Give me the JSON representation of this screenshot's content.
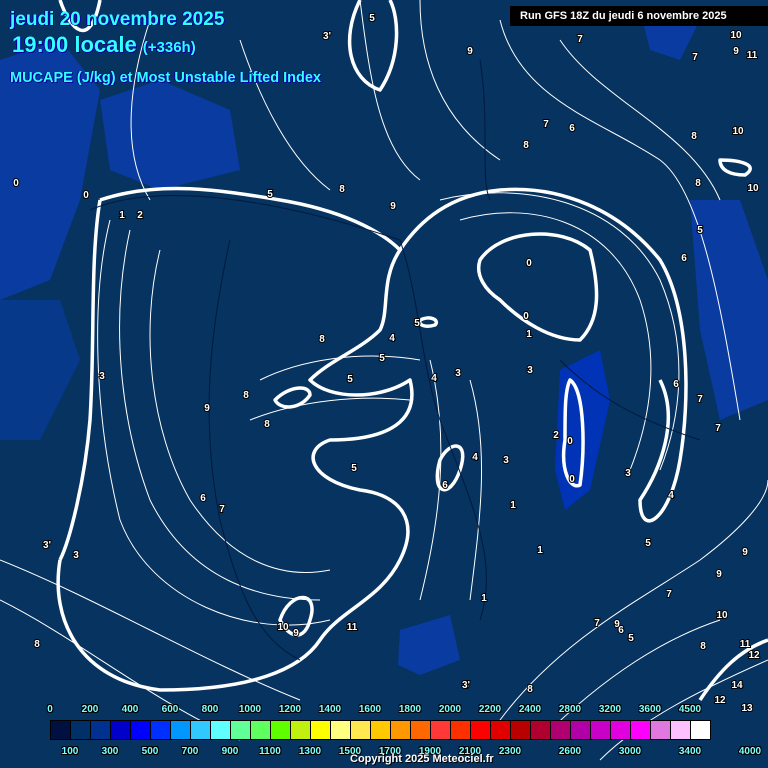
{
  "header": {
    "date": "jeudi 20 novembre 2025",
    "time": "19:00 locale",
    "lead": "(+336h)",
    "parameter": "MUCAPE (J/kg) et Most Unstable Lifted Index",
    "run": "Run GFS 18Z du jeudi 6 novembre 2025"
  },
  "legend": {
    "colors": [
      "#001040",
      "#003068",
      "#003090",
      "#0000c8",
      "#0000ff",
      "#0030ff",
      "#0098ff",
      "#30c8ff",
      "#60ffff",
      "#60ff98",
      "#60ff60",
      "#60ff00",
      "#c0f010",
      "#ffff00",
      "#ffff80",
      "#ffe850",
      "#ffc800",
      "#ff9800",
      "#ff6800",
      "#ff3838",
      "#ff3000",
      "#ff0000",
      "#e00000",
      "#b80000",
      "#b00030",
      "#b00070",
      "#b000a8",
      "#c800c8",
      "#e000e0",
      "#ff00ff",
      "#e078e0",
      "#ffc0ff",
      "#ffffff"
    ],
    "top_labels": [
      "0",
      "200",
      "400",
      "600",
      "800",
      "1000",
      "1200",
      "1400",
      "1600",
      "1800",
      "2000",
      "2200",
      "2400",
      "2800",
      "3200",
      "3600",
      "4500"
    ],
    "bottom_labels": [
      "100",
      "300",
      "500",
      "700",
      "900",
      "1100",
      "1300",
      "1500",
      "1700",
      "1900",
      "2100",
      "2300",
      "2600",
      "3000",
      "3400",
      "4000"
    ]
  },
  "map_labels": [
    "5",
    "3'",
    "9",
    "7",
    "10",
    "9",
    "11",
    "7",
    "0",
    "0",
    "1",
    "2",
    "5",
    "8",
    "9",
    "7",
    "6",
    "8",
    "8",
    "10",
    "8",
    "10",
    "5",
    "6",
    "0",
    "0",
    "1",
    "3",
    "8",
    "5",
    "4",
    "5",
    "5",
    "3",
    "4",
    "8",
    "8",
    "9",
    "3",
    "6",
    "7",
    "3'",
    "3",
    "5",
    "6",
    "4",
    "3",
    "2",
    "1",
    "0",
    "0",
    "3",
    "4",
    "5",
    "6",
    "7",
    "7",
    "3",
    "1",
    "1",
    "10",
    "9",
    "11",
    "7",
    "6",
    "5",
    "8",
    "9",
    "10",
    "11",
    "12",
    "14",
    "12",
    "13",
    "3'",
    "8",
    "7",
    "9",
    "9",
    "8"
  ],
  "copyright": "Copyright 2025 Meteociel.fr"
}
